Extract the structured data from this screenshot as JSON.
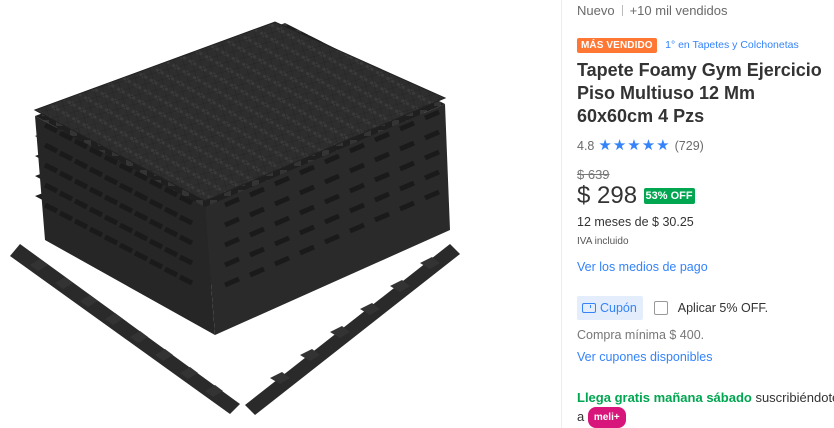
{
  "product": {
    "condition": "Nuevo",
    "sold": "+10 mil vendidos",
    "badge": "MÁS VENDIDO",
    "rank": "1° en Tapetes y Colchonetas",
    "title": "Tapete Foamy Gym Ejercicio Piso Multiuso 12 Mm 60x60cm 4 Pzs",
    "rating": "4.8",
    "stars": "★★★★★",
    "reviews": "(729)",
    "old_price": "$ 639",
    "price": "$ 298",
    "discount": "53% OFF",
    "installments": "12 meses de $ 30.25",
    "tax_note": "IVA incluido",
    "payment_link": "Ver los medios de pago"
  },
  "coupon": {
    "button_label": "Cupón",
    "apply_label": "Aplicar 5% OFF.",
    "min_purchase": "Compra mínima $ 400.",
    "link": "Ver cupones disponibles"
  },
  "shipping": {
    "free_text": "Llega gratis mañana sábado",
    "suffix": " suscribiéndote a ",
    "meli_label": "meli+"
  },
  "colors": {
    "accent": "#3483fa",
    "badge": "#ff7733",
    "discount": "#00a650",
    "meli": "#d8157a",
    "mat": "#2f2f2f"
  }
}
